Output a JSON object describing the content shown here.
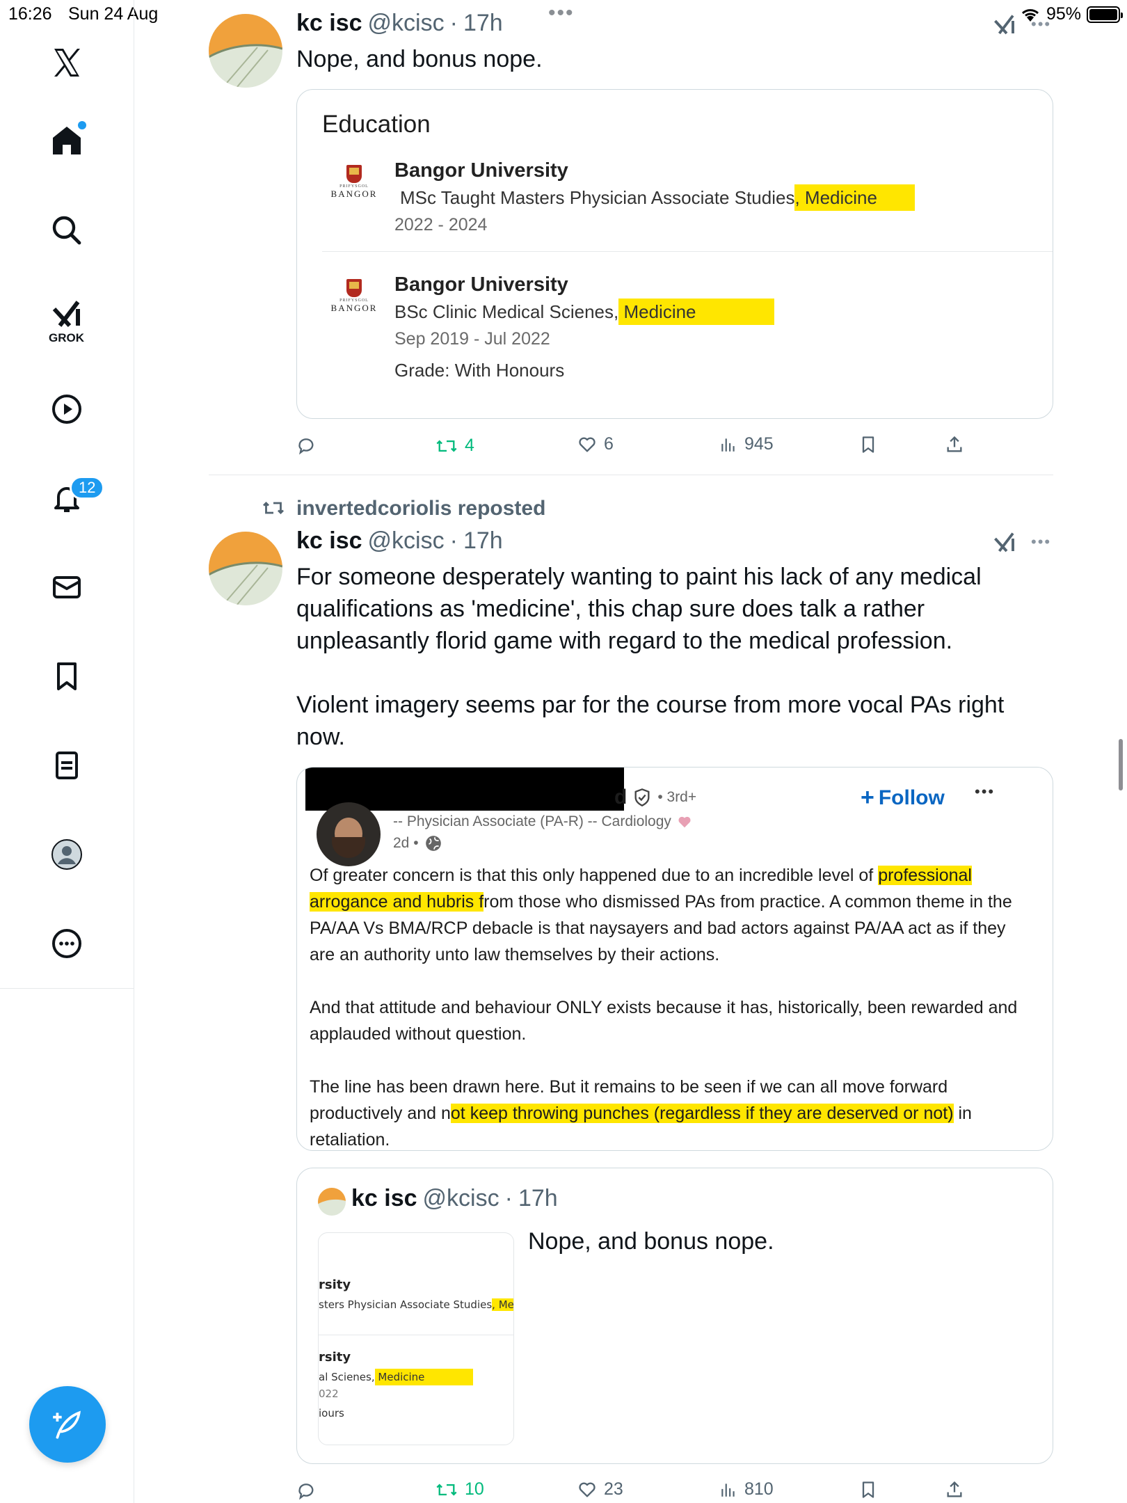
{
  "status": {
    "time": "16:26",
    "date": "Sun 24 Aug",
    "battery": "95%"
  },
  "sidebar": {
    "grok_label": "GROK",
    "notifications_badge": "12"
  },
  "tweet1": {
    "name": "kc isc",
    "handle": "@kcisc",
    "age": "17h",
    "text": "Nope, and bonus nope.",
    "education": {
      "title": "Education",
      "logo_small": "PRIFYSGOL",
      "logo_big": "BANGOR",
      "entries": [
        {
          "school": "Bangor University",
          "degree_prefix": "MSc Taught Masters Physician Associate Studies",
          "degree_highlight": ", Medicine",
          "dates": "2022 - 2024",
          "grade": ""
        },
        {
          "school": "Bangor University",
          "degree_prefix": "BSc Clinic Medical Scienes,",
          "degree_highlight": " Medicine",
          "dates": "Sep 2019 - Jul 2022",
          "grade": "Grade: With Honours"
        }
      ]
    },
    "actions": {
      "replies": "",
      "reposts": "4",
      "likes": "6",
      "views": "945"
    }
  },
  "tweet2": {
    "repost_label": "invertedcoriolis reposted",
    "name": "kc isc",
    "handle": "@kcisc",
    "age": "17h",
    "text_p1": "For someone desperately wanting to paint his lack of any medical qualifications as 'medicine', this chap sure does talk a rather unpleasantly florid game with regard to the medical profession.",
    "text_p2": "Violent imagery seems par for the course from more vocal PAs right now.",
    "linkedin": {
      "name_tail": "d",
      "degree": "• 3rd+",
      "headline": "-- Physician Associate (PA-R) -- Cardiology",
      "posted": "2d •",
      "follow_label": "Follow",
      "p1_a": "Of greater concern is that this only happened due to an incredible level of ",
      "p1_hl": "professional arrogance and hubris f",
      "p1_b": "rom those who dismissed PAs from practice. A common theme in the PA/AA Vs BMA/RCP debacle is that naysayers and bad actors against PA/AA act as if they are an authority unto law themselves by their actions.",
      "p2": "And that attitude and behaviour ONLY exists because it has, historically, been rewarded and applauded without question.",
      "p3_a": "The line has been drawn here. But it remains to be seen if we can all move forward productively and n",
      "p3_hl": "ot keep throwing punches (regardless if they are deserved or not)",
      "p3_b": " in retaliation."
    },
    "quote": {
      "name": "kc isc",
      "handle": "@kcisc",
      "age": "17h",
      "text": "Nope, and bonus nope.",
      "thumb_l1": "rsity",
      "thumb_l2": "sters Physician Associate Studies",
      "thumb_l2_hl": ", Medi",
      "thumb_l3": "rsity",
      "thumb_l4": "al Scienes,",
      "thumb_l4_hl": " Medicine",
      "thumb_l5": "022",
      "thumb_l6": "iours"
    },
    "actions": {
      "replies": "",
      "reposts": "10",
      "likes": "23",
      "views": "810"
    }
  },
  "colors": {
    "accent": "#1d9bf0",
    "highlight": "#ffe600",
    "repost_green": "#00ba7c",
    "linkedin_blue": "#0a66c2"
  }
}
